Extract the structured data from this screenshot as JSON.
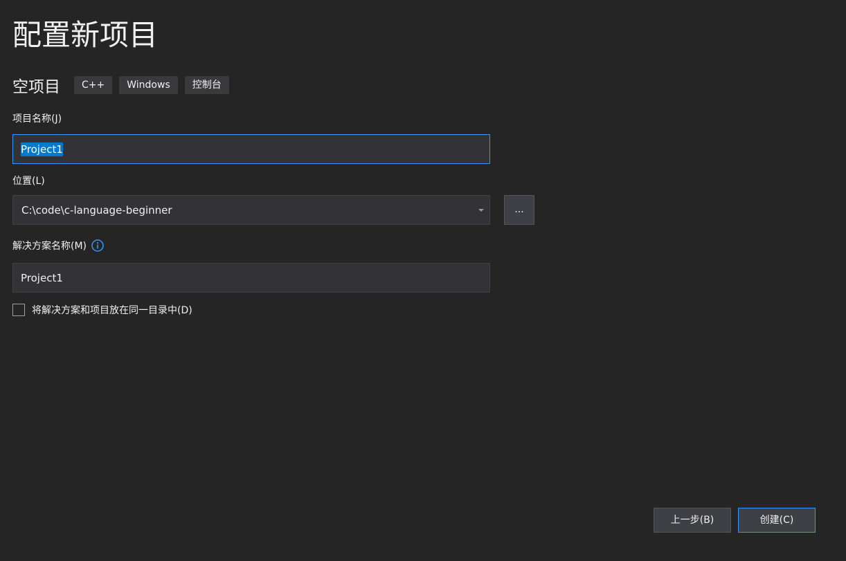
{
  "page_title": "配置新项目",
  "template": {
    "name": "空项目",
    "tags": [
      "C++",
      "Windows",
      "控制台"
    ]
  },
  "project_name": {
    "label": "项目名称(J)",
    "value": "Project1"
  },
  "location": {
    "label": "位置(L)",
    "value": "C:\\code\\c-language-beginner",
    "browse_label": "..."
  },
  "solution_name": {
    "label": "解决方案名称(M)",
    "value": "Project1",
    "info_icon": "info-circle-icon"
  },
  "same_directory": {
    "label": "将解决方案和项目放在同一目录中(D)",
    "checked": false
  },
  "buttons": {
    "back": "上一步(B)",
    "create": "创建(C)"
  },
  "colors": {
    "background": "#252526",
    "input_background": "#333337",
    "accent": "#3399ff",
    "selection": "#007acc"
  }
}
